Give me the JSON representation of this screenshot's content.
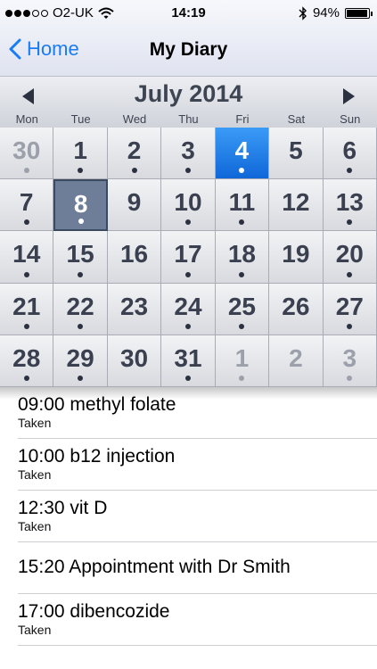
{
  "status_bar": {
    "carrier": "O2-UK",
    "signal_bars": 3,
    "time": "14:19",
    "battery": "94%",
    "battery_level": 0.94
  },
  "nav": {
    "back_label": "Home",
    "title": "My Diary"
  },
  "calendar": {
    "month": "July 2014",
    "weekdays": [
      "Mon",
      "Tue",
      "Wed",
      "Thu",
      "Fri",
      "Sat",
      "Sun"
    ],
    "days": [
      {
        "n": "30",
        "other": true,
        "dot": true
      },
      {
        "n": "1",
        "dot": true
      },
      {
        "n": "2",
        "dot": true
      },
      {
        "n": "3",
        "dot": true
      },
      {
        "n": "4",
        "dot": true,
        "today": true
      },
      {
        "n": "5",
        "dot": false
      },
      {
        "n": "6",
        "dot": true
      },
      {
        "n": "7",
        "dot": true
      },
      {
        "n": "8",
        "dot": true,
        "selected": true
      },
      {
        "n": "9",
        "dot": false
      },
      {
        "n": "10",
        "dot": true
      },
      {
        "n": "11",
        "dot": true
      },
      {
        "n": "12",
        "dot": false
      },
      {
        "n": "13",
        "dot": true
      },
      {
        "n": "14",
        "dot": true
      },
      {
        "n": "15",
        "dot": true
      },
      {
        "n": "16",
        "dot": false
      },
      {
        "n": "17",
        "dot": true
      },
      {
        "n": "18",
        "dot": true
      },
      {
        "n": "19",
        "dot": false
      },
      {
        "n": "20",
        "dot": true
      },
      {
        "n": "21",
        "dot": true
      },
      {
        "n": "22",
        "dot": true
      },
      {
        "n": "23",
        "dot": false
      },
      {
        "n": "24",
        "dot": true
      },
      {
        "n": "25",
        "dot": true
      },
      {
        "n": "26",
        "dot": false
      },
      {
        "n": "27",
        "dot": true
      },
      {
        "n": "28",
        "dot": true
      },
      {
        "n": "29",
        "dot": true
      },
      {
        "n": "30",
        "dot": false
      },
      {
        "n": "31",
        "dot": true
      },
      {
        "n": "1",
        "other": true,
        "dot": true
      },
      {
        "n": "2",
        "other": true,
        "dot": false
      },
      {
        "n": "3",
        "other": true,
        "dot": true
      }
    ]
  },
  "events": [
    {
      "title": "09:00 methyl folate",
      "status": "Taken"
    },
    {
      "title": "10:00 b12 injection",
      "status": "Taken"
    },
    {
      "title": "12:30 vit D",
      "status": "Taken"
    },
    {
      "title": "15:20 Appointment with Dr Smith",
      "status": ""
    },
    {
      "title": "17:00 dibencozide",
      "status": "Taken"
    }
  ],
  "colors": {
    "accent": "#1a7cf5",
    "today": "#0f67d8",
    "selected": "#6e7e98"
  }
}
